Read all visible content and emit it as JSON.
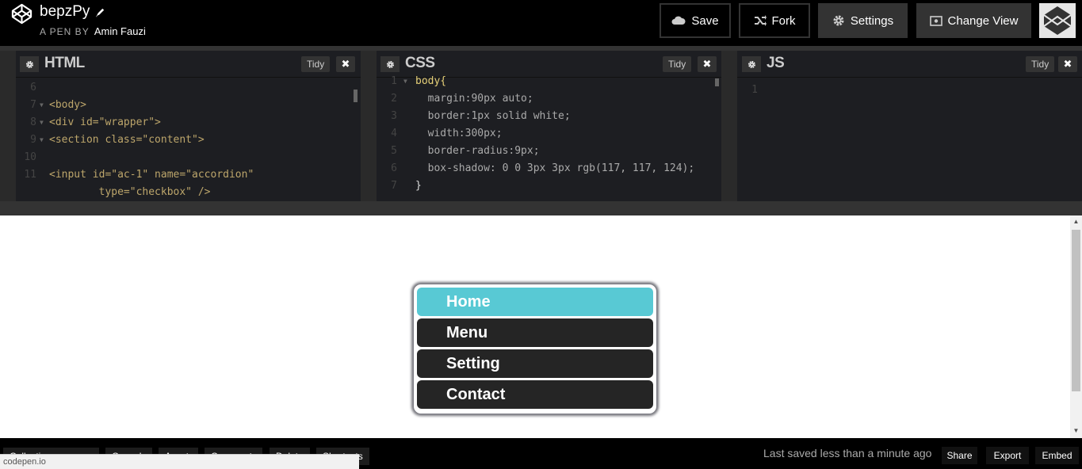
{
  "header": {
    "pen_title": "bepzPy",
    "pen_by_prefix": "A PEN BY",
    "author": "Amin Fauzi",
    "buttons": {
      "save": "Save",
      "fork": "Fork",
      "settings": "Settings",
      "change_view": "Change View"
    }
  },
  "editors": {
    "html": {
      "title": "HTML",
      "tidy": "Tidy",
      "lines": [
        {
          "n": "6",
          "text": ""
        },
        {
          "n": "7",
          "text": "<body>"
        },
        {
          "n": "8",
          "text": "<div id=\"wrapper\">"
        },
        {
          "n": "9",
          "text": "<section class=\"content\">"
        },
        {
          "n": "10",
          "text": ""
        },
        {
          "n": "11",
          "text": "<input id=\"ac-1\" name=\"accordion\""
        },
        {
          "n": "",
          "text": "        type=\"checkbox\" />"
        }
      ]
    },
    "css": {
      "title": "CSS",
      "tidy": "Tidy",
      "lines": [
        {
          "n": "1",
          "text": "body{"
        },
        {
          "n": "2",
          "text": "  margin:90px auto;"
        },
        {
          "n": "3",
          "text": "  border:1px solid white;"
        },
        {
          "n": "4",
          "text": "  width:300px;"
        },
        {
          "n": "5",
          "text": "  border-radius:9px;"
        },
        {
          "n": "6",
          "text": "  box-shadow: 0 0 3px 3px rgb(117, 117, 124);"
        },
        {
          "n": "7",
          "text": "}"
        }
      ]
    },
    "js": {
      "title": "JS",
      "tidy": "Tidy",
      "lines": [
        {
          "n": "1",
          "text": ""
        }
      ]
    }
  },
  "preview": {
    "menu": [
      "Home",
      "Menu",
      "Setting",
      "Contact"
    ]
  },
  "footer": {
    "left_buttons": [
      "Collections",
      "Console",
      "Assets",
      "Comments",
      "Delete",
      "Shortcuts"
    ],
    "saved_text": "Last saved less than a minute ago",
    "share": "Share",
    "export": "Export",
    "embed": "Embed",
    "status_url": "codepen.io"
  },
  "colors": {
    "accent_active": "#58c9d4",
    "menu_dark": "#252525",
    "background": "#000000"
  }
}
